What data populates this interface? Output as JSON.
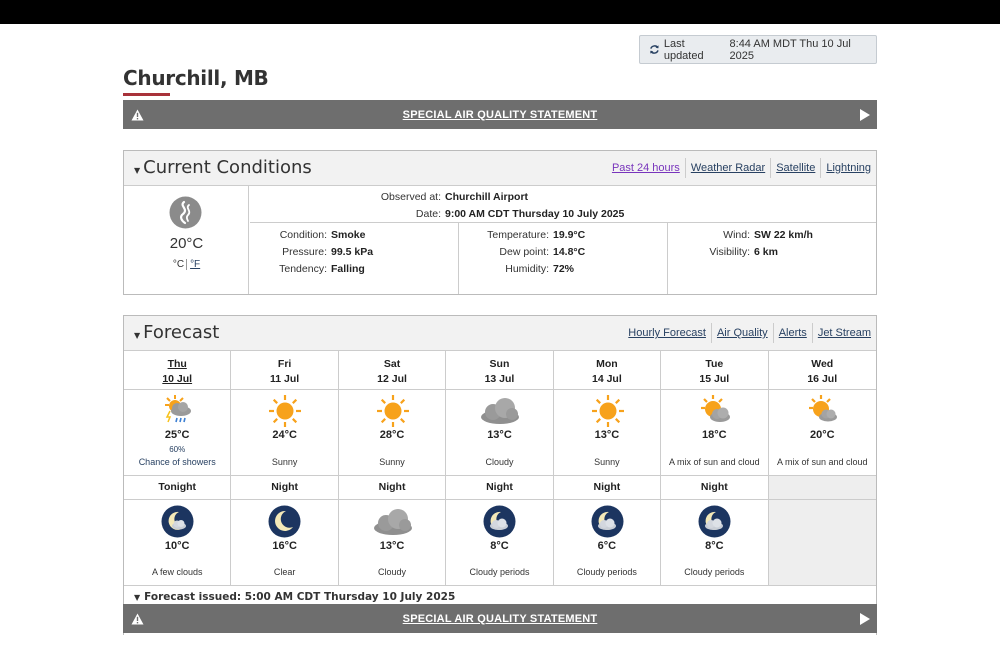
{
  "updated": {
    "label": "Last updated",
    "value": "8:44 AM MDT Thu 10 Jul 2025"
  },
  "city": "Churchill, MB",
  "alert": {
    "label": "SPECIAL AIR QUALITY STATEMENT"
  },
  "current": {
    "title": "Current Conditions",
    "links": [
      "Past 24 hours",
      "Weather Radar",
      "Satellite",
      "Lightning"
    ],
    "temp": "20°C",
    "unit_c": "°C",
    "unit_f": "°F",
    "observed_label": "Observed at:",
    "observed_value": "Churchill Airport",
    "date_label": "Date:",
    "date_value": "9:00 AM CDT Thursday 10 July 2025",
    "condition_label": "Condition:",
    "condition_value": "Smoke",
    "pressure_label": "Pressure:",
    "pressure_value": "99.5 kPa",
    "tendency_label": "Tendency:",
    "tendency_value": "Falling",
    "temperature_label": "Temperature:",
    "temperature_value": "19.9°C",
    "dewpoint_label": "Dew point:",
    "dewpoint_value": "14.8°C",
    "humidity_label": "Humidity:",
    "humidity_value": "72%",
    "wind_label": "Wind:",
    "wind_value": "SW 22 km/h",
    "visibility_label": "Visibility:",
    "visibility_value": "6 km"
  },
  "forecast": {
    "title": "Forecast",
    "links": [
      "Hourly Forecast",
      "Air Quality",
      "Alerts",
      "Jet Stream"
    ],
    "days": [
      {
        "day": "Thu",
        "date": "10 Jul",
        "temp": "25°C",
        "pop": "60%",
        "summary": "Chance of showers",
        "icon": "sun-cloud-rain-icon"
      },
      {
        "day": "Fri",
        "date": "11 Jul",
        "temp": "24°C",
        "pop": "",
        "summary": "Sunny",
        "icon": "sun-icon"
      },
      {
        "day": "Sat",
        "date": "12 Jul",
        "temp": "28°C",
        "pop": "",
        "summary": "Sunny",
        "icon": "sun-icon"
      },
      {
        "day": "Sun",
        "date": "13 Jul",
        "temp": "13°C",
        "pop": "",
        "summary": "Cloudy",
        "icon": "cloud-icon"
      },
      {
        "day": "Mon",
        "date": "14 Jul",
        "temp": "13°C",
        "pop": "",
        "summary": "Sunny",
        "icon": "sun-icon"
      },
      {
        "day": "Tue",
        "date": "15 Jul",
        "temp": "18°C",
        "pop": "",
        "summary": "A mix of sun and cloud",
        "icon": "sun-cloud-icon"
      },
      {
        "day": "Wed",
        "date": "16 Jul",
        "temp": "20°C",
        "pop": "",
        "summary": "A mix of sun and cloud",
        "icon": "sun-cloud-icon"
      }
    ],
    "nights": [
      {
        "label": "Tonight",
        "temp": "10°C",
        "summary": "A few clouds",
        "icon": "moon-cloud-icon"
      },
      {
        "label": "Night",
        "temp": "16°C",
        "summary": "Clear",
        "icon": "moon-icon"
      },
      {
        "label": "Night",
        "temp": "13°C",
        "summary": "Cloudy",
        "icon": "cloud-icon"
      },
      {
        "label": "Night",
        "temp": "8°C",
        "summary": "Cloudy periods",
        "icon": "moon-cloud-icon"
      },
      {
        "label": "Night",
        "temp": "6°C",
        "summary": "Cloudy periods",
        "icon": "moon-cloud-icon"
      },
      {
        "label": "Night",
        "temp": "8°C",
        "summary": "Cloudy periods",
        "icon": "moon-cloud-icon"
      }
    ],
    "issued": "Forecast issued: 5:00 AM CDT Thursday 10 July 2025"
  },
  "colors": {
    "alert_bg": "#6e6e6e",
    "accent": "#a8323a",
    "link": "#284162",
    "sun": "#f7a21b"
  }
}
